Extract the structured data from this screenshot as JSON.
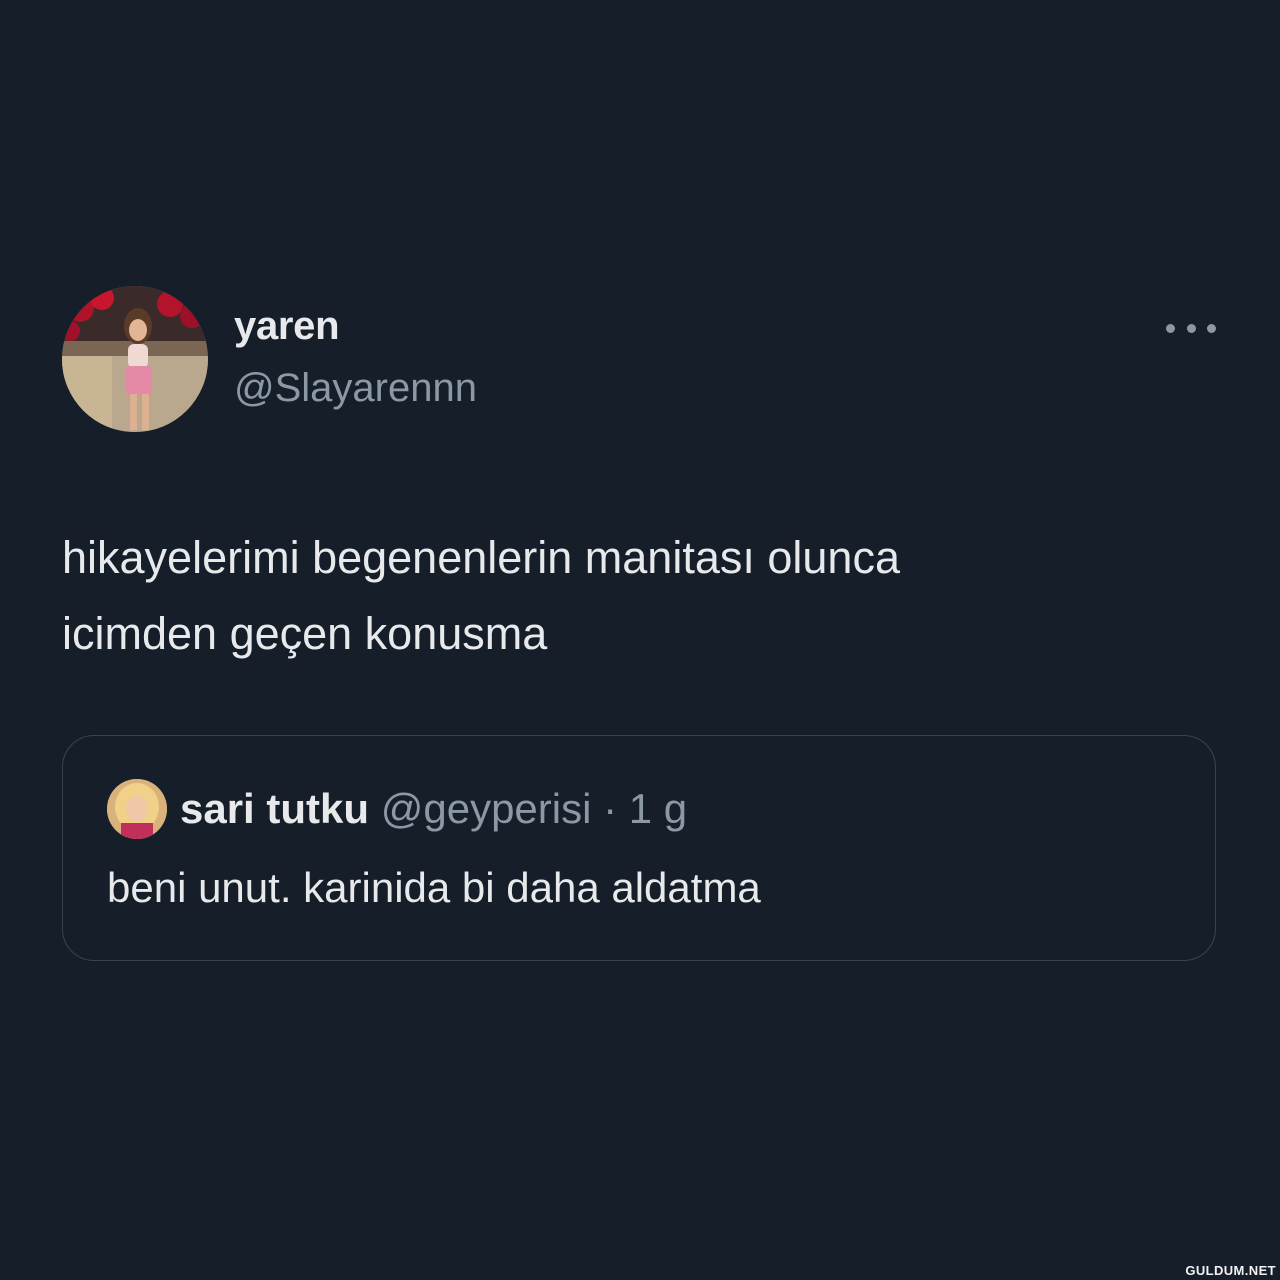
{
  "tweet": {
    "author": {
      "display_name": "yaren",
      "handle": "@Slayarennn"
    },
    "more_icon": "more-horizontal-icon",
    "text_lines": [
      "hikayelerimi begenenlerin manitası olunca",
      "icimden geçen konusma"
    ],
    "quote": {
      "display_name": "sari tutku",
      "handle": "@geyperisi",
      "separator": "·",
      "time": "1 g",
      "text": "beni unut. karinida bi daha aldatma"
    }
  },
  "watermark": "GULDUM.NET",
  "colors": {
    "background": "#161e2a",
    "text_primary": "#e7e9ea",
    "text_secondary": "#8b98a5",
    "border": "#38444d"
  }
}
